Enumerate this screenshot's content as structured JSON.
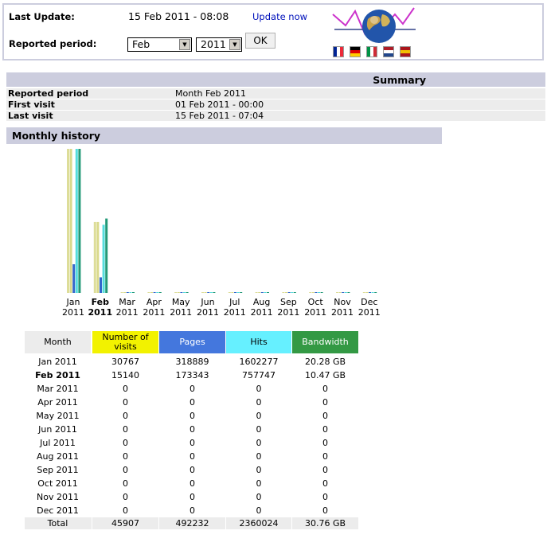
{
  "header": {
    "last_update_label": "Last Update:",
    "last_update_value": "15 Feb 2011 - 08:08",
    "update_now_link": "Update now",
    "reported_period_label": "Reported period:",
    "month_select_value": "Feb",
    "year_select_value": "2011",
    "ok_button": "OK"
  },
  "flags": [
    {
      "icon": "flag-france-icon",
      "colors": [
        "#002395",
        "#ffffff",
        "#ed2939"
      ],
      "dir": "v"
    },
    {
      "icon": "flag-germany-icon",
      "colors": [
        "#000000",
        "#dd0000",
        "#ffce00"
      ],
      "dir": "h"
    },
    {
      "icon": "flag-italy-icon",
      "colors": [
        "#009246",
        "#ffffff",
        "#ce2b37"
      ],
      "dir": "v"
    },
    {
      "icon": "flag-netherlands-icon",
      "colors": [
        "#ae1c28",
        "#ffffff",
        "#21468b"
      ],
      "dir": "h"
    },
    {
      "icon": "flag-spain-icon",
      "colors": [
        "#aa151b",
        "#f1bf00",
        "#aa151b"
      ],
      "dir": "h"
    }
  ],
  "summary": {
    "title": "Summary",
    "rows": [
      {
        "label": "Reported period",
        "value": "Month Feb 2011"
      },
      {
        "label": "First visit",
        "value": "01 Feb 2011 - 00:00"
      },
      {
        "label": "Last visit",
        "value": "15 Feb 2011 - 07:04"
      }
    ]
  },
  "monthly_history": {
    "title": "Monthly history",
    "columns": [
      "Month",
      "Number of visits",
      "Pages",
      "Hits",
      "Bandwidth"
    ],
    "column_colors": [
      "#ececec",
      "#f2f200",
      "#4477dd",
      "#66f0ff",
      "#339944"
    ],
    "rows": [
      {
        "month": "Jan 2011",
        "visits": "30767",
        "pages": "318889",
        "hits": "1602277",
        "bandwidth": "20.28 GB",
        "bold": false
      },
      {
        "month": "Feb 2011",
        "visits": "15140",
        "pages": "173343",
        "hits": "757747",
        "bandwidth": "10.47 GB",
        "bold": true
      },
      {
        "month": "Mar 2011",
        "visits": "0",
        "pages": "0",
        "hits": "0",
        "bandwidth": "0",
        "bold": false
      },
      {
        "month": "Apr 2011",
        "visits": "0",
        "pages": "0",
        "hits": "0",
        "bandwidth": "0",
        "bold": false
      },
      {
        "month": "May 2011",
        "visits": "0",
        "pages": "0",
        "hits": "0",
        "bandwidth": "0",
        "bold": false
      },
      {
        "month": "Jun 2011",
        "visits": "0",
        "pages": "0",
        "hits": "0",
        "bandwidth": "0",
        "bold": false
      },
      {
        "month": "Jul 2011",
        "visits": "0",
        "pages": "0",
        "hits": "0",
        "bandwidth": "0",
        "bold": false
      },
      {
        "month": "Aug 2011",
        "visits": "0",
        "pages": "0",
        "hits": "0",
        "bandwidth": "0",
        "bold": false
      },
      {
        "month": "Sep 2011",
        "visits": "0",
        "pages": "0",
        "hits": "0",
        "bandwidth": "0",
        "bold": false
      },
      {
        "month": "Oct 2011",
        "visits": "0",
        "pages": "0",
        "hits": "0",
        "bandwidth": "0",
        "bold": false
      },
      {
        "month": "Nov 2011",
        "visits": "0",
        "pages": "0",
        "hits": "0",
        "bandwidth": "0",
        "bold": false
      },
      {
        "month": "Dec 2011",
        "visits": "0",
        "pages": "0",
        "hits": "0",
        "bandwidth": "0",
        "bold": false
      }
    ],
    "total": {
      "label": "Total",
      "visits": "45907",
      "pages": "492232",
      "hits": "2360024",
      "bandwidth": "30.76 GB"
    }
  },
  "chart_data": {
    "type": "bar",
    "categories": [
      {
        "month": "Jan",
        "year": "2011"
      },
      {
        "month": "Feb",
        "year": "2011"
      },
      {
        "month": "Mar",
        "year": "2011"
      },
      {
        "month": "Apr",
        "year": "2011"
      },
      {
        "month": "May",
        "year": "2011"
      },
      {
        "month": "Jun",
        "year": "2011"
      },
      {
        "month": "Jul",
        "year": "2011"
      },
      {
        "month": "Aug",
        "year": "2011"
      },
      {
        "month": "Sep",
        "year": "2011"
      },
      {
        "month": "Oct",
        "year": "2011"
      },
      {
        "month": "Nov",
        "year": "2011"
      },
      {
        "month": "Dec",
        "year": "2011"
      }
    ],
    "highlight_category": 1,
    "series": [
      {
        "key": "visitors",
        "color": "#dddd99",
        "values": [
          null,
          null,
          0,
          0,
          0,
          0,
          0,
          0,
          0,
          0,
          0,
          0
        ]
      },
      {
        "key": "visits",
        "color": "#d9d98c",
        "values": [
          30767,
          15140,
          0,
          0,
          0,
          0,
          0,
          0,
          0,
          0,
          0,
          0
        ]
      },
      {
        "key": "pages",
        "color": "#3366cc",
        "values": [
          318889,
          173343,
          0,
          0,
          0,
          0,
          0,
          0,
          0,
          0,
          0,
          0
        ]
      },
      {
        "key": "hits",
        "color": "#55dddd",
        "values": [
          1602277,
          757747,
          0,
          0,
          0,
          0,
          0,
          0,
          0,
          0,
          0,
          0
        ]
      },
      {
        "key": "bandwidth",
        "color": "#229977",
        "values": [
          20.28,
          10.47,
          0,
          0,
          0,
          0,
          0,
          0,
          0,
          0,
          0,
          0
        ]
      }
    ]
  }
}
